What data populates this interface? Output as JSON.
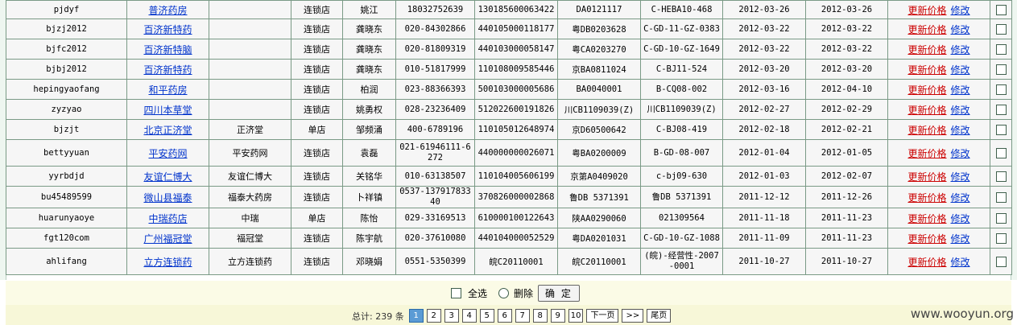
{
  "table": {
    "rows": [
      {
        "user": "pjdyf",
        "name": "普济药房",
        "alias": "",
        "type": "连锁店",
        "contact": "姚江",
        "phone": "18032752639",
        "license": "130185600063422",
        "code1": "DA0121117",
        "code2": "C-HEBA10-468",
        "date1": "2012-03-26",
        "date2": "2012-03-26"
      },
      {
        "user": "bjzj2012",
        "name": "百济新特药",
        "alias": "",
        "type": "连锁店",
        "contact": "龚晓东",
        "phone": "020-84302866",
        "license": "440105000118177",
        "code1": "粤DB0203628",
        "code2": "C-GD-11-GZ-0383",
        "date1": "2012-03-22",
        "date2": "2012-03-22"
      },
      {
        "user": "bjfc2012",
        "name": "百济新特脑",
        "alias": "",
        "type": "连锁店",
        "contact": "龚晓东",
        "phone": "020-81809319",
        "license": "440103000058147",
        "code1": "粤CA0203270",
        "code2": "C-GD-10-GZ-1649",
        "date1": "2012-03-22",
        "date2": "2012-03-22"
      },
      {
        "user": "bjbj2012",
        "name": "百济新特药",
        "alias": "",
        "type": "连锁店",
        "contact": "龚晓东",
        "phone": "010-51817999",
        "license": "110108009585446",
        "code1": "京BA0811024",
        "code2": "C-BJ11-524",
        "date1": "2012-03-20",
        "date2": "2012-03-20"
      },
      {
        "user": "hepingyaofang",
        "name": "和平药房",
        "alias": "",
        "type": "连锁店",
        "contact": "柏润",
        "phone": "023-88366393",
        "license": "500103000005686",
        "code1": "BA0040001",
        "code2": "B-CQ08-002",
        "date1": "2012-03-16",
        "date2": "2012-04-10"
      },
      {
        "user": "zyzyao",
        "name": "四川本草堂",
        "alias": "",
        "type": "连锁店",
        "contact": "姚勇权",
        "phone": "028-23236409",
        "license": "512022600191826",
        "code1": "川CB1109039(Z)",
        "code2": "川CB1109039(Z)",
        "date1": "2012-02-27",
        "date2": "2012-02-29"
      },
      {
        "user": "bjzjt",
        "name": "北京正济堂",
        "alias": "正济堂",
        "type": "单店",
        "contact": "邹频涌",
        "phone": "400-6789196",
        "license": "110105012648974",
        "code1": "京D60500642",
        "code2": "C-BJ08-419",
        "date1": "2012-02-18",
        "date2": "2012-02-21"
      },
      {
        "user": "bettyyuan",
        "name": "平安药网",
        "alias": "平安药网",
        "type": "连锁店",
        "contact": "袁磊",
        "phone": "021-61946111-6272",
        "license": "440000000026071",
        "code1": "粤BA0200009",
        "code2": "B-GD-08-007",
        "date1": "2012-01-04",
        "date2": "2012-01-05"
      },
      {
        "user": "yyrbdjd",
        "name": "友谊仁博大",
        "alias": "友谊仁博大",
        "type": "连锁店",
        "contact": "关铭华",
        "phone": "010-63138507",
        "license": "110104005606199",
        "code1": "京第A0409020",
        "code2": "c-bj09-630",
        "date1": "2012-01-03",
        "date2": "2012-02-07"
      },
      {
        "user": "bu45489599",
        "name": "微山县福泰",
        "alias": "福泰大药房",
        "type": "连锁店",
        "contact": "卜祥镇",
        "phone": "0537-13791783340",
        "license": "370826000002868",
        "code1": "鲁DB 5371391",
        "code2": "鲁DB 5371391",
        "date1": "2011-12-12",
        "date2": "2011-12-26"
      },
      {
        "user": "huarunyaoye",
        "name": "中瑞药店",
        "alias": "中瑞",
        "type": "单店",
        "contact": "陈怡",
        "phone": "029-33169513",
        "license": "610000100122643",
        "code1": "陕AA0290060",
        "code2": "021309564",
        "date1": "2011-11-18",
        "date2": "2011-11-23"
      },
      {
        "user": "fgt120com",
        "name": "广州福冠堂",
        "alias": "福冠堂",
        "type": "连锁店",
        "contact": "陈宇航",
        "phone": "020-37610080",
        "license": "440104000052529",
        "code1": "粤DA0201031",
        "code2": "C-GD-10-GZ-1088",
        "date1": "2011-11-09",
        "date2": "2011-11-23"
      },
      {
        "user": "ahlifang",
        "name": "立方连锁药",
        "alias": "立方连锁药",
        "type": "连锁店",
        "contact": "邓晓娟",
        "phone": "0551-5350399",
        "license": "皖C20110001",
        "code1": "皖C20110001",
        "code2": "(皖)-经营性-2007-0001",
        "date1": "2011-10-27",
        "date2": "2011-10-27"
      }
    ],
    "update_price_label": "更新价格",
    "edit_label": "修改"
  },
  "actions": {
    "select_all_label": "全选",
    "delete_label": "删除",
    "confirm_label": "确 定"
  },
  "pager": {
    "total_text": "总计: 239 条",
    "pages": [
      "1",
      "2",
      "3",
      "4",
      "5",
      "6",
      "7",
      "8",
      "9",
      "10"
    ],
    "current": "1",
    "next_label": "下一页",
    "jump_label": ">>",
    "last_label": "尾页"
  },
  "watermark": "www.wooyun.org",
  "colors": {
    "update_link": "#cc0000",
    "name_link": "#0033cc",
    "current_page": "#5b9bd5",
    "pager_bg": "#f7f7d8",
    "action_bg": "#fbfbe6",
    "grid_border": "#7a9a86"
  }
}
